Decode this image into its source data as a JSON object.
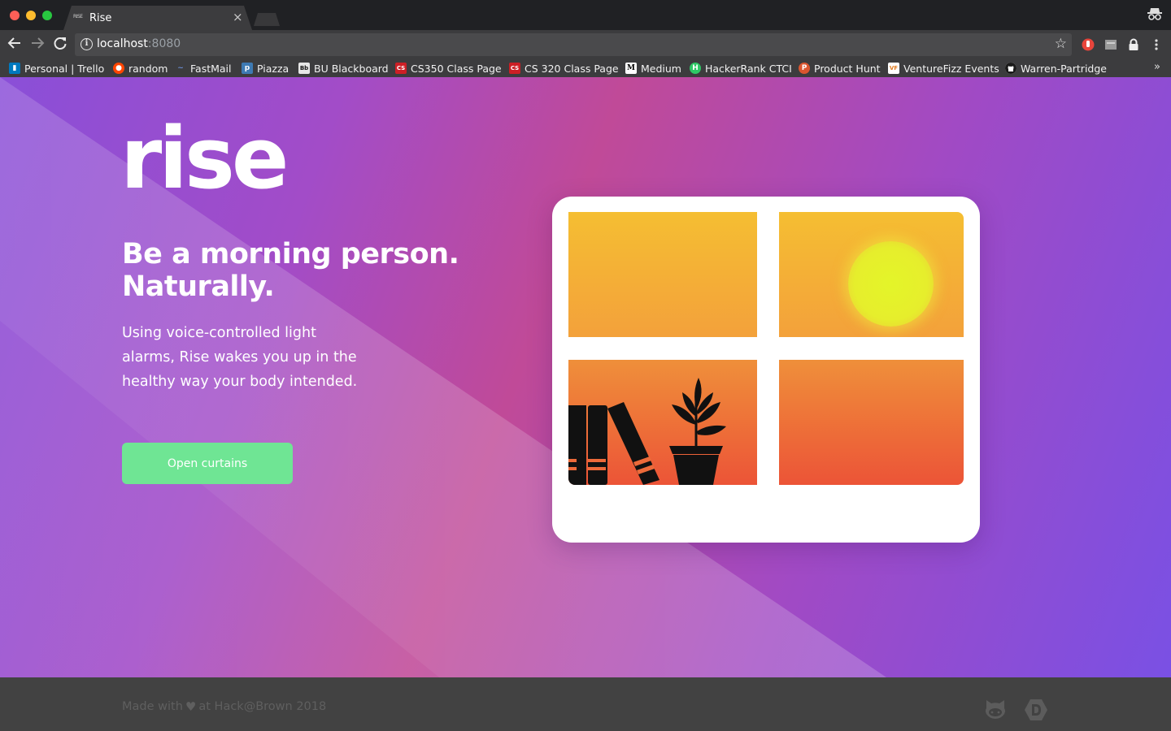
{
  "browser": {
    "tab_title": "Rise",
    "tab_favicon_text": "RISE",
    "tab_close_glyph": "×",
    "url_host": "localhost",
    "url_port": ":8080",
    "icons": {
      "back": "back-arrow-icon",
      "forward": "forward-arrow-icon",
      "reload": "reload-icon",
      "info": "info-icon",
      "bookmark_star": "star-icon",
      "incognito": "incognito-icon",
      "menu": "kebab-menu-icon"
    },
    "bookmarks": [
      {
        "label": "Personal | Trello",
        "icon": "T",
        "color": "#0079bf"
      },
      {
        "label": "random",
        "icon": "r",
        "color": "#ff4500"
      },
      {
        "label": "FastMail",
        "icon": "~",
        "color": "#3f5e98"
      },
      {
        "label": "Piazza",
        "icon": "p",
        "color": "#3e7ab3"
      },
      {
        "label": "BU Blackboard",
        "icon": "Bb",
        "color": "#2b2b2b"
      },
      {
        "label": "CS350 Class Page",
        "icon": "CS",
        "color": "#cc1f25"
      },
      {
        "label": "CS 320 Class Page",
        "icon": "CS",
        "color": "#cc1f25"
      },
      {
        "label": "Medium",
        "icon": "M",
        "color": "#000000"
      },
      {
        "label": "HackerRank CTCI",
        "icon": "H",
        "color": "#2ec866"
      },
      {
        "label": "Product Hunt",
        "icon": "P",
        "color": "#da552f"
      },
      {
        "label": "VentureFizz Events",
        "icon": "VF",
        "color": "#ffffff"
      },
      {
        "label": "Warren-Partridge",
        "icon": "gh",
        "color": "#1b1b1b"
      }
    ],
    "bookmarks_overflow": "»"
  },
  "page": {
    "logo": "rise",
    "headline": "Be a morning person. Naturally.",
    "description": "Using voice-controlled light alarms, Rise wakes you up in the healthy way your body intended.",
    "cta_label": "Open curtains",
    "illustration": {
      "icons": [
        "sun-icon",
        "books-icon",
        "plant-icon"
      ],
      "colors": {
        "sky_top": "#f5be32",
        "sky_bottom": "#ec5437",
        "sun": "#e4f529",
        "frame": "#ffffff"
      }
    }
  },
  "footer": {
    "text_before": "Made with",
    "heart_glyph": "♥",
    "text_after": "at Hack@Brown 2018",
    "icons": [
      "github-icon",
      "devpost-icon"
    ]
  },
  "colors": {
    "accent_button": "#6fe594",
    "footer_bg": "#424242",
    "footer_text": "#5f5f5f",
    "hero_gradient": [
      "#8a4fd8",
      "#c04a98",
      "#7a50e4"
    ]
  }
}
